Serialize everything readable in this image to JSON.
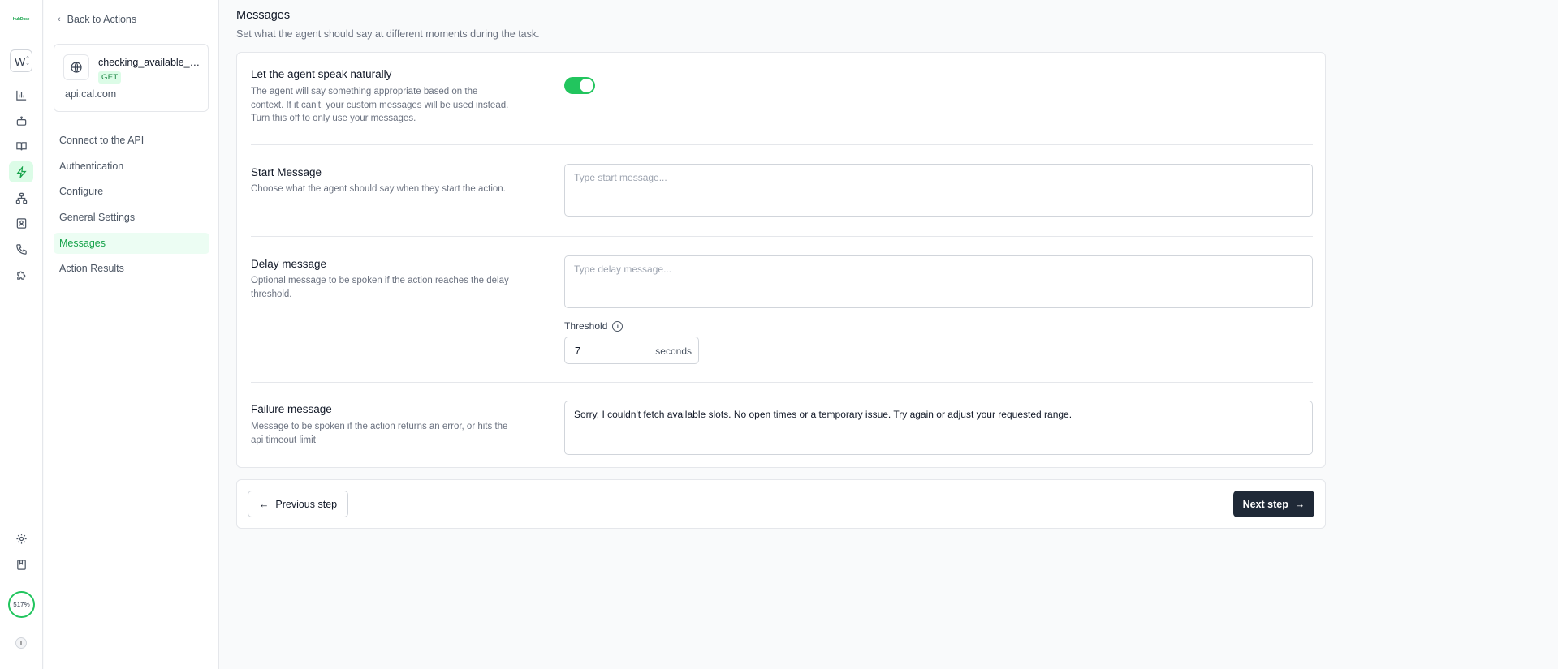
{
  "rail": {
    "logo_text": "HubDose",
    "workspace_letter": "W",
    "usage_percent": "517%",
    "user_initial": "I",
    "active_color": "#16a34a",
    "icons": [
      "bar-chart-icon",
      "robot-icon",
      "book-icon",
      "lightning-icon",
      "org-chart-icon",
      "contact-card-icon",
      "phone-icon",
      "puzzle-icon",
      "gear-icon",
      "notebook-icon"
    ]
  },
  "sidebar": {
    "back_label": "Back to Actions",
    "action": {
      "name": "checking_available_slots",
      "method": "GET",
      "host": "api.cal.com"
    },
    "nav": [
      {
        "label": "Connect to the API",
        "active": false
      },
      {
        "label": "Authentication",
        "active": false
      },
      {
        "label": "Configure",
        "active": false
      },
      {
        "label": "General Settings",
        "active": false
      },
      {
        "label": "Messages",
        "active": true
      },
      {
        "label": "Action Results",
        "active": false
      }
    ]
  },
  "main": {
    "title": "Messages",
    "subtitle": "Set what the agent should say at different moments during the task.",
    "speak_naturally": {
      "title": "Let the agent speak naturally",
      "description": "The agent will say something appropriate based on the context. If it can't, your custom messages will be used instead. Turn this off to only use your messages.",
      "enabled": true
    },
    "start_message": {
      "title": "Start Message",
      "description": "Choose what the agent should say when they start the action.",
      "placeholder": "Type start message...",
      "value": ""
    },
    "delay_message": {
      "title": "Delay message",
      "description": "Optional message to be spoken if the action reaches the delay threshold.",
      "placeholder": "Type delay message...",
      "value": "",
      "threshold_label": "Threshold",
      "threshold_value": "7",
      "threshold_unit": "seconds"
    },
    "failure_message": {
      "title": "Failure message",
      "description": "Message to be spoken if the action returns an error, or hits the api timeout limit",
      "value": "Sorry, I couldn't fetch available slots. No open times or a temporary issue. Try again or adjust your requested range."
    }
  },
  "footer": {
    "prev_label": "Previous step",
    "next_label": "Next step"
  }
}
